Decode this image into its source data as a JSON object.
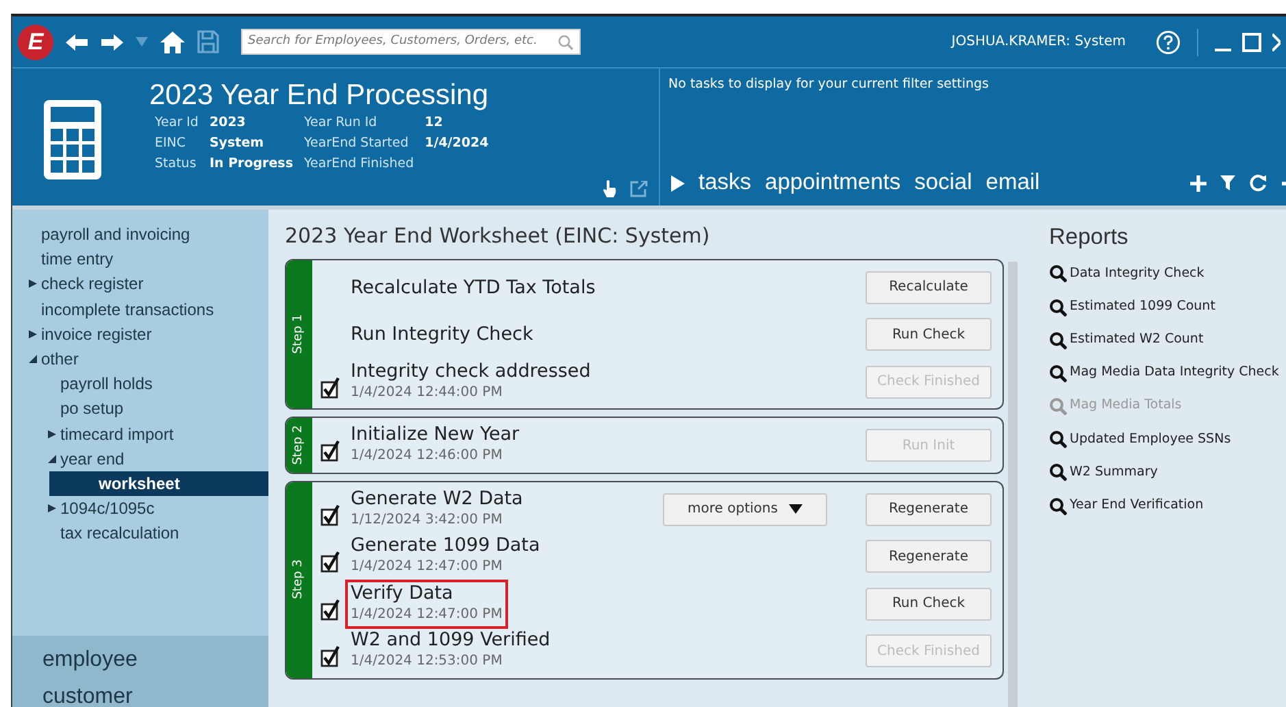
{
  "topbar": {
    "logo_letter": "E",
    "search": {
      "placeholder": "Search for Employees, Customers, Orders, etc."
    },
    "user": "JOSHUA.KRAMER: System"
  },
  "header": {
    "title": "2023 Year End Processing",
    "fields": [
      {
        "label": "Year Id",
        "value": "2023"
      },
      {
        "label": "Year Run Id",
        "value": "12"
      },
      {
        "label": "EINC",
        "value": "System"
      },
      {
        "label": "YearEnd Started",
        "value": "1/4/2024"
      },
      {
        "label": "Status",
        "value": "In Progress"
      },
      {
        "label": "YearEnd Finished"
      }
    ]
  },
  "tasks_panel": {
    "message": "No tasks to display for your current filter settings",
    "tabs": [
      {
        "label": "tasks"
      },
      {
        "label": "appointments"
      },
      {
        "label": "social"
      },
      {
        "label": "email"
      }
    ]
  },
  "sidebar": {
    "items": [
      {
        "label": "payroll and invoicing",
        "selected": false
      },
      {
        "label": "time entry",
        "selected": false
      },
      {
        "label": "check register",
        "expanded": false,
        "selected": false
      },
      {
        "label": "incomplete transactions",
        "selected": false
      },
      {
        "label": "invoice register",
        "expanded": false,
        "selected": false
      },
      {
        "label": "other",
        "expanded": true,
        "selected": false,
        "children": [
          {
            "label": "payroll holds",
            "selected": false
          },
          {
            "label": "po setup",
            "selected": false
          },
          {
            "label": "timecard import",
            "expanded": false,
            "selected": false
          },
          {
            "label": "year end",
            "expanded": true,
            "selected": false,
            "children": [
              {
                "label": "worksheet",
                "selected": true
              }
            ]
          },
          {
            "label": "1094c/1095c",
            "expanded": false,
            "selected": false
          },
          {
            "label": "tax recalculation",
            "selected": false
          }
        ]
      }
    ],
    "sections": [
      "employee",
      "customer"
    ]
  },
  "worksheet": {
    "title": "2023 Year End Worksheet (EINC: System)",
    "steps": [
      {
        "label": "Step 1",
        "tasks": [
          {
            "title": "Recalculate YTD Tax Totals",
            "checked": false,
            "button": {
              "label": "Recalculate",
              "disabled": false
            }
          },
          {
            "title": "Run Integrity Check",
            "checked": false,
            "button": {
              "label": "Run Check",
              "disabled": false
            }
          },
          {
            "title": "Integrity check addressed",
            "checked": true,
            "timestamp": "1/4/2024 12:44:00 PM",
            "button": {
              "label": "Check Finished",
              "disabled": true
            }
          }
        ]
      },
      {
        "label": "Step 2",
        "tasks": [
          {
            "title": "Initialize New Year",
            "checked": true,
            "timestamp": "1/4/2024 12:46:00 PM",
            "button": {
              "label": "Run Init",
              "disabled": true
            }
          }
        ]
      },
      {
        "label": "Step 3",
        "tasks": [
          {
            "title": "Generate W2 Data",
            "checked": true,
            "timestamp": "1/12/2024 3:42:00 PM",
            "menu_button": "more options",
            "button": {
              "label": "Regenerate",
              "disabled": false
            }
          },
          {
            "title": "Generate 1099 Data",
            "checked": true,
            "timestamp": "1/4/2024 12:47:00 PM",
            "button": {
              "label": "Regenerate",
              "disabled": false
            }
          },
          {
            "title": "Verify Data",
            "checked": true,
            "highlighted": true,
            "timestamp": "1/4/2024 12:47:00 PM",
            "button": {
              "label": "Run Check",
              "disabled": false
            }
          },
          {
            "title": "W2 and 1099 Verified",
            "checked": true,
            "timestamp": "1/4/2024 12:53:00 PM",
            "button": {
              "label": "Check Finished",
              "disabled": true
            }
          }
        ]
      }
    ]
  },
  "reports": {
    "title": "Reports",
    "items": [
      {
        "label": "Data Integrity Check",
        "disabled": false
      },
      {
        "label": "Estimated 1099 Count",
        "disabled": false
      },
      {
        "label": "Estimated W2 Count",
        "disabled": false
      },
      {
        "label": "Mag Media Data Integrity Check",
        "disabled": false
      },
      {
        "label": "Mag Media Totals",
        "disabled": true
      },
      {
        "label": "Updated Employee SSNs",
        "disabled": false
      },
      {
        "label": "W2 Summary",
        "disabled": false
      },
      {
        "label": "Year End Verification",
        "disabled": false
      }
    ]
  }
}
